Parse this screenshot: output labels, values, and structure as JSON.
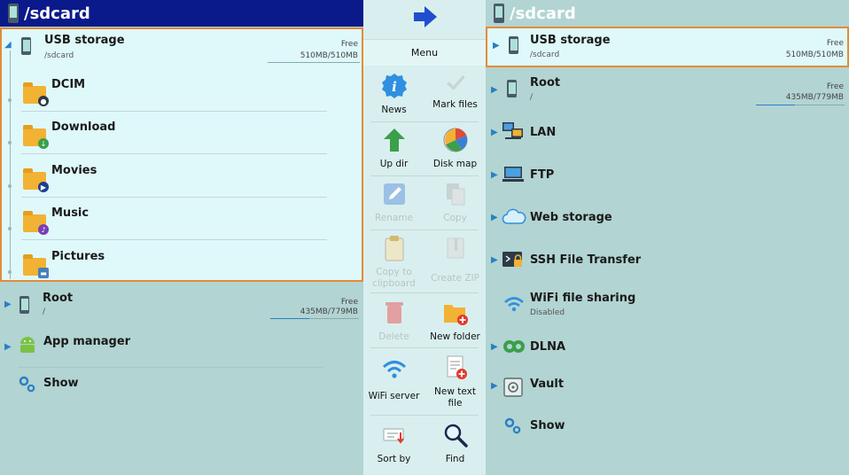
{
  "left": {
    "header_title": "/sdcard",
    "usb": {
      "name": "USB storage",
      "path": "/sdcard",
      "free_label": "Free",
      "free_value": "510MB/510MB"
    },
    "folders": [
      {
        "name": "DCIM",
        "icon": "camera-folder-icon"
      },
      {
        "name": "Download",
        "icon": "download-folder-icon"
      },
      {
        "name": "Movies",
        "icon": "movies-folder-icon"
      },
      {
        "name": "Music",
        "icon": "music-folder-icon"
      },
      {
        "name": "Pictures",
        "icon": "pictures-folder-icon"
      }
    ],
    "root": {
      "name": "Root",
      "path": "/",
      "free_label": "Free",
      "free_value": "435MB/779MB"
    },
    "app_manager": "App manager",
    "show": "Show"
  },
  "menu": {
    "title": "Menu",
    "items": [
      {
        "label": "News",
        "enabled": true
      },
      {
        "label": "Mark files",
        "enabled": true
      },
      {
        "label": "Up dir",
        "enabled": true
      },
      {
        "label": "Disk map",
        "enabled": true
      },
      {
        "label": "Rename",
        "enabled": false
      },
      {
        "label": "Copy",
        "enabled": false
      },
      {
        "label": "Copy to clipboard",
        "enabled": false
      },
      {
        "label": "Create ZIP",
        "enabled": false
      },
      {
        "label": "Delete",
        "enabled": false
      },
      {
        "label": "New folder",
        "enabled": true
      },
      {
        "label": "WiFi server",
        "enabled": true
      },
      {
        "label": "New text file",
        "enabled": true
      },
      {
        "label": "Sort by",
        "enabled": true
      },
      {
        "label": "Find",
        "enabled": true
      }
    ]
  },
  "right": {
    "header_title": "/sdcard",
    "usb": {
      "name": "USB storage",
      "path": "/sdcard",
      "free_label": "Free",
      "free_value": "510MB/510MB"
    },
    "root": {
      "name": "Root",
      "path": "/",
      "free_label": "Free",
      "free_value": "435MB/779MB"
    },
    "items": [
      {
        "name": "LAN"
      },
      {
        "name": "FTP"
      },
      {
        "name": "Web storage"
      },
      {
        "name": "SSH File Transfer"
      },
      {
        "name": "WiFi file sharing",
        "sub": "Disabled"
      },
      {
        "name": "DLNA"
      },
      {
        "name": "Vault"
      },
      {
        "name": "Show"
      }
    ]
  },
  "colors": {
    "header_blue": "#0b1a8a",
    "highlight_border": "#e38b3a",
    "accent": "#2a7fc4",
    "panel_bg": "#b2d4d2"
  }
}
